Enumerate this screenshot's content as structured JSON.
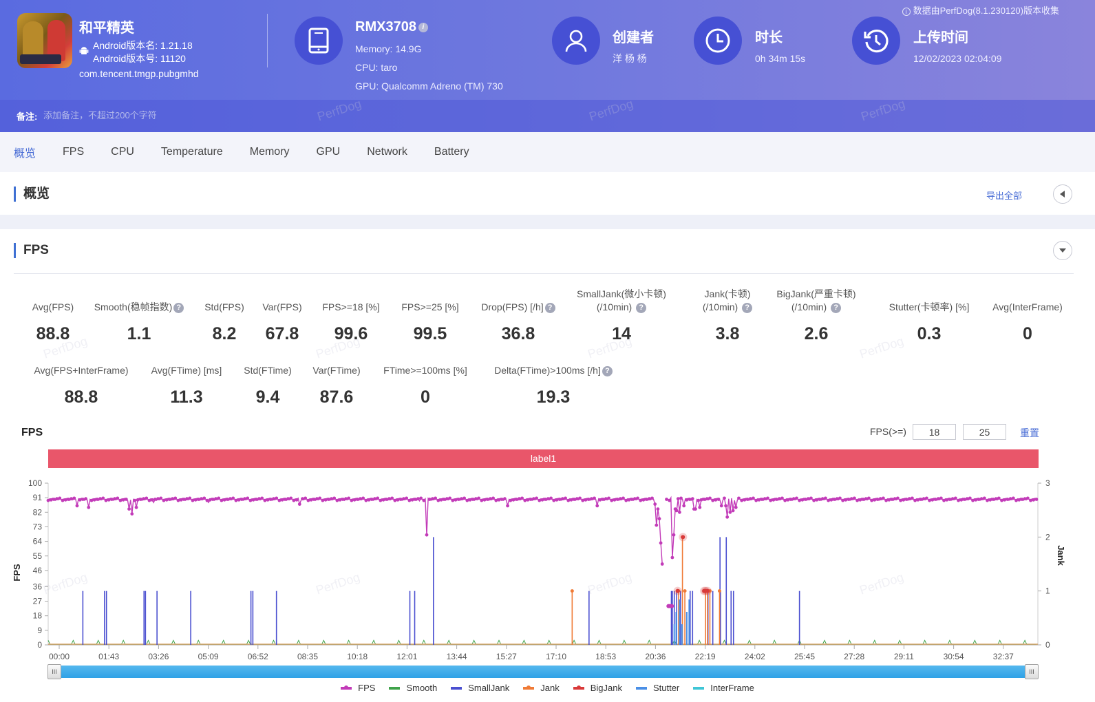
{
  "header": {
    "app": {
      "name": "和平精英",
      "version_name": "Android版本名: 1.21.18",
      "version_code": "Android版本号: 11120",
      "package": "com.tencent.tmgp.pubgmhd"
    },
    "device": {
      "model": "RMX3708",
      "memory": "Memory: 14.9G",
      "cpu": "CPU: taro",
      "gpu": "GPU: Qualcomm Adreno (TM) 730"
    },
    "creator": {
      "title": "创建者",
      "value": "洋 杨 杨"
    },
    "duration": {
      "title": "时长",
      "value": "0h 34m 15s"
    },
    "upload": {
      "title": "上传时间",
      "value": "12/02/2023 02:04:09"
    },
    "collect_note": "数据由PerfDog(8.1.230120)版本收集",
    "note": {
      "label": "备注:",
      "placeholder": "添加备注，不超过200个字符"
    },
    "watermark": "PerfDog"
  },
  "tabs": [
    {
      "label": "概览",
      "active": true
    },
    {
      "label": "FPS"
    },
    {
      "label": "CPU"
    },
    {
      "label": "Temperature"
    },
    {
      "label": "Memory"
    },
    {
      "label": "GPU"
    },
    {
      "label": "Network"
    },
    {
      "label": "Battery"
    }
  ],
  "overview": {
    "title": "概览",
    "export_label": "导出全部"
  },
  "fps_section": {
    "title": "FPS",
    "stats_row1": [
      {
        "label": "Avg(FPS)",
        "value": "88.8"
      },
      {
        "label": "Smooth(稳帧指数)",
        "value": "1.1",
        "help": true
      },
      {
        "label": "Std(FPS)",
        "value": "8.2"
      },
      {
        "label": "Var(FPS)",
        "value": "67.8"
      },
      {
        "label": "FPS>=18 [%]",
        "value": "99.6"
      },
      {
        "label": "FPS>=25 [%]",
        "value": "99.5"
      },
      {
        "label": "Drop(FPS) [/h]",
        "value": "36.8",
        "help": true
      },
      {
        "label": "SmallJank(微小卡顿)",
        "label2": "(/10min)",
        "value": "14",
        "help": true
      },
      {
        "label": "Jank(卡顿)",
        "label2": "(/10min)",
        "value": "3.8",
        "help": true
      },
      {
        "label": "BigJank(严重卡顿)",
        "label2": "(/10min)",
        "value": "2.6",
        "help": true
      },
      {
        "label": "Stutter(卡顿率) [%]",
        "value": "0.3"
      },
      {
        "label": "Avg(InterFrame)",
        "value": "0"
      }
    ],
    "stats_row2": [
      {
        "label": "Avg(FPS+InterFrame)",
        "value": "88.8"
      },
      {
        "label": "Avg(FTime) [ms]",
        "value": "11.3"
      },
      {
        "label": "Std(FTime)",
        "value": "9.4"
      },
      {
        "label": "Var(FTime)",
        "value": "87.6"
      },
      {
        "label": "FTime>=100ms [%]",
        "value": "0"
      },
      {
        "label": "Delta(FTime)>100ms [/h]",
        "value": "19.3",
        "help": true
      }
    ],
    "chart_title": "FPS",
    "threshold_label": "FPS(>=)",
    "threshold1": "18",
    "threshold2": "25",
    "reset_label": "重置",
    "label_bar": "label1"
  },
  "chart_data": {
    "type": "line",
    "title": "FPS",
    "ylabel": "FPS",
    "y2label": "Jank",
    "ylim": [
      0,
      100
    ],
    "y2lim": [
      0,
      3
    ],
    "yticks": [
      0,
      9,
      18,
      27,
      36,
      46,
      55,
      64,
      73,
      82,
      91,
      100
    ],
    "y2ticks": [
      0,
      1,
      2,
      3
    ],
    "xticks": [
      "00:00",
      "01:43",
      "03:26",
      "05:09",
      "06:52",
      "08:35",
      "10:18",
      "12:01",
      "13:44",
      "15:27",
      "17:10",
      "18:53",
      "20:36",
      "22:19",
      "24:02",
      "25:45",
      "27:28",
      "29:11",
      "30:54",
      "32:37"
    ],
    "duration_seconds": 2055,
    "legend_position": "bottom",
    "series": [
      {
        "name": "FPS",
        "color": "#c23bb8",
        "axis": "left",
        "baseline": 90,
        "dips": [
          [
            60,
            86
          ],
          [
            85,
            85
          ],
          [
            168,
            84
          ],
          [
            175,
            81
          ],
          [
            184,
            85
          ],
          [
            220,
            88
          ],
          [
            333,
            88
          ],
          [
            522,
            87
          ],
          [
            770,
            89
          ],
          [
            786,
            68
          ],
          [
            955,
            86
          ],
          [
            1140,
            86
          ],
          [
            1260,
            87
          ],
          [
            1264,
            74
          ],
          [
            1265,
            84
          ],
          [
            1270,
            78
          ],
          [
            1272,
            63
          ],
          [
            1273,
            57
          ],
          [
            1274,
            50
          ],
          [
            1276,
            56
          ],
          [
            1283,
            90
          ],
          [
            1294,
            91
          ],
          [
            1297,
            54
          ],
          [
            1298,
            68
          ],
          [
            1300,
            66
          ],
          [
            1302,
            84
          ],
          [
            1304,
            83
          ],
          [
            1310,
            82
          ],
          [
            1321,
            86
          ],
          [
            1340,
            84
          ],
          [
            1345,
            84
          ],
          [
            1354,
            85
          ],
          [
            1399,
            86
          ],
          [
            1408,
            86
          ],
          [
            1410,
            79
          ],
          [
            1415,
            82
          ],
          [
            1422,
            83
          ],
          [
            1429,
            85
          ]
        ]
      },
      {
        "name": "Smooth",
        "color": "#3fa34a",
        "axis": "left",
        "values_note": "near 0 with small spikes"
      },
      {
        "name": "SmallJank",
        "color": "#4a4fd0",
        "axis": "right",
        "events": [
          [
            72,
            1
          ],
          [
            117,
            1
          ],
          [
            121,
            1
          ],
          [
            199,
            1
          ],
          [
            202,
            1
          ],
          [
            226,
            1
          ],
          [
            296,
            1
          ],
          [
            421,
            1
          ],
          [
            425,
            1
          ],
          [
            474,
            1
          ],
          [
            751,
            1
          ],
          [
            761,
            1
          ],
          [
            800,
            2
          ],
          [
            1123,
            1
          ],
          [
            1294,
            1
          ],
          [
            1296,
            1
          ],
          [
            1300,
            1
          ],
          [
            1305,
            1
          ],
          [
            1313,
            1
          ],
          [
            1333,
            1
          ],
          [
            1338,
            1
          ],
          [
            1370,
            1
          ],
          [
            1380,
            1
          ],
          [
            1395,
            2
          ],
          [
            1396,
            1
          ],
          [
            1408,
            2
          ],
          [
            1418,
            1
          ],
          [
            1423,
            1
          ],
          [
            1560,
            1
          ]
        ]
      },
      {
        "name": "Jank",
        "color": "#f07b37",
        "axis": "right",
        "events": [
          [
            1088,
            1
          ],
          [
            1309,
            1
          ],
          [
            1317,
            2
          ],
          [
            1322,
            1
          ],
          [
            1365,
            1
          ],
          [
            1369,
            1
          ],
          [
            1374,
            1
          ],
          [
            1394,
            1
          ]
        ]
      },
      {
        "name": "BigJank",
        "color": "#d93a3a",
        "axis": "right",
        "events": [
          [
            1307,
            1
          ],
          [
            1318,
            2
          ],
          [
            1362,
            1
          ],
          [
            1365,
            1
          ],
          [
            1369,
            1
          ]
        ]
      },
      {
        "name": "Stutter",
        "color": "#4a8fe6",
        "axis": "right",
        "values_note": "small spikes around 21:00-21:30"
      },
      {
        "name": "InterFrame",
        "color": "#3fc6d6",
        "axis": "right",
        "values_note": "0"
      }
    ]
  }
}
